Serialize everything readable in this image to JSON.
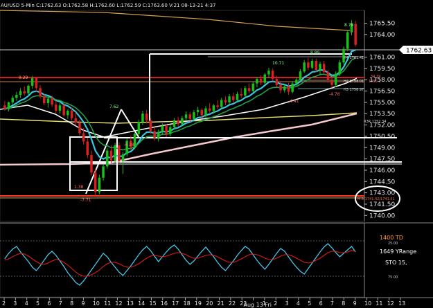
{
  "header": {
    "symbol": "AU/USD  5-Min",
    "ohlc": "C:1762.63  O:1762.58  H:1762.60  L:1762.59  C:1763.60  V:21  08-13-21  4:37",
    "full_line": "AU/USD 5-Min C:1762.63 O:1762.58 H:1762.60 L:1762.59 C:1763.60 V:21 08-13-21 4:37"
  },
  "colors": {
    "background": "#000000",
    "bullish_candle": "#18c118",
    "bearish_candle": "#d82020",
    "ema_fast": "#39c6e0",
    "ema_slow": "#22a04a",
    "white_ma": "#ffffff",
    "pink_ma": "#f6c8d0",
    "orange_line": "#d8a050",
    "yellow_ma": "#e8e070",
    "red_support": "#ff3a1a",
    "stoch_line": "#49c5e8",
    "stoch_signal": "#e01a1a"
  },
  "price_axis": {
    "ylim": [
      1739.2,
      1767.2
    ],
    "ticks": [
      "1765.50",
      "1764.00",
      "1761.00",
      "1759.50",
      "1758.00",
      "1756.50",
      "1755.00",
      "1753.50",
      "1752.00",
      "1750.50",
      "1749.00",
      "1747.50",
      "1746.00",
      "1744.50",
      "1743.00",
      "1741.50",
      "1740.00"
    ],
    "current_price": "1762.63"
  },
  "time_axis": {
    "labels": [
      "2",
      "3",
      "4",
      "5",
      "6",
      "7",
      "8",
      "9",
      "10",
      "11",
      "12",
      "13",
      "14",
      "15",
      "16",
      "17",
      "18",
      "19",
      "20",
      "21",
      "22",
      "23",
      "Aug 13 Fri",
      "1",
      "2",
      "3",
      "4",
      "5",
      "6",
      "7",
      "8",
      "9",
      "10",
      "11",
      "12",
      "13"
    ]
  },
  "chart_labels": {
    "high_label": "8.78",
    "left_label": "9.29",
    "mid_label": "7.62",
    "low_label": "-7.71",
    "low2_label": "-4.38",
    "low3_label": "1.38",
    "right_label1": "10.71",
    "right_label2": "-4.78",
    "right_label3": "8.89",
    "right_label4": "-4.41",
    "h4_level": "H4  1761.41",
    "h4b_level": "H4  1758.01",
    "h3_level": "H3  1756.97",
    "r3r_level": "R3R  1752.34",
    "red_right_a": "34.19",
    "red_right_b": "1760.1",
    "ml_level": "M.3  1741.42/1741.51"
  },
  "indicator": {
    "label_td": "1400 TD",
    "label_yrange": "1649 YRange",
    "label_sto": "STO  15,",
    "tick_top": "25.00",
    "tick_bottom": "75.00"
  },
  "chart_data": [
    {
      "type": "candlestick",
      "title": "",
      "ylim": [
        1739.2,
        1767.2
      ],
      "candles": [
        [
          1754.6,
          1755.2,
          1753.9,
          1754.1
        ],
        [
          1754.1,
          1755.1,
          1753.8,
          1755.0
        ],
        [
          1755.0,
          1755.9,
          1754.7,
          1755.6
        ],
        [
          1755.6,
          1756.4,
          1755.2,
          1756.0
        ],
        [
          1756.0,
          1756.9,
          1755.6,
          1756.5
        ],
        [
          1756.5,
          1757.1,
          1755.9,
          1756.2
        ],
        [
          1756.2,
          1757.4,
          1756.0,
          1757.2
        ],
        [
          1757.2,
          1758.5,
          1756.8,
          1758.2
        ],
        [
          1758.2,
          1758.4,
          1756.4,
          1756.9
        ],
        [
          1756.9,
          1757.3,
          1755.5,
          1755.8
        ],
        [
          1755.8,
          1756.1,
          1754.6,
          1754.9
        ],
        [
          1754.9,
          1755.7,
          1754.3,
          1755.5
        ],
        [
          1755.5,
          1755.9,
          1754.4,
          1754.7
        ],
        [
          1754.7,
          1755.2,
          1753.6,
          1753.9
        ],
        [
          1753.9,
          1754.9,
          1753.5,
          1754.6
        ],
        [
          1754.6,
          1754.9,
          1753.1,
          1753.3
        ],
        [
          1753.3,
          1754.1,
          1752.8,
          1753.9
        ],
        [
          1753.9,
          1754.3,
          1752.6,
          1752.9
        ],
        [
          1752.9,
          1753.7,
          1751.9,
          1752.3
        ],
        [
          1752.3,
          1752.7,
          1750.6,
          1750.9
        ],
        [
          1750.9,
          1751.6,
          1749.4,
          1749.8
        ],
        [
          1749.8,
          1750.3,
          1747.6,
          1748.0
        ],
        [
          1748.0,
          1748.6,
          1745.3,
          1745.7
        ],
        [
          1745.7,
          1746.2,
          1742.6,
          1743.1
        ],
        [
          1743.1,
          1745.4,
          1742.8,
          1745.0
        ],
        [
          1745.0,
          1746.8,
          1744.6,
          1746.5
        ],
        [
          1746.5,
          1748.9,
          1746.2,
          1748.6
        ],
        [
          1748.6,
          1749.3,
          1746.9,
          1747.3
        ],
        [
          1747.3,
          1749.6,
          1747.0,
          1749.3
        ],
        [
          1749.3,
          1749.7,
          1746.8,
          1747.2
        ],
        [
          1747.2,
          1748.4,
          1745.5,
          1748.1
        ],
        [
          1748.1,
          1750.2,
          1747.8,
          1749.9
        ],
        [
          1749.9,
          1750.6,
          1748.6,
          1749.0
        ],
        [
          1749.0,
          1751.1,
          1748.8,
          1750.8
        ],
        [
          1750.8,
          1752.7,
          1750.5,
          1752.4
        ],
        [
          1752.4,
          1753.9,
          1752.0,
          1753.5
        ],
        [
          1753.5,
          1754.0,
          1752.2,
          1752.6
        ],
        [
          1752.6,
          1752.9,
          1750.8,
          1751.2
        ],
        [
          1751.2,
          1751.7,
          1749.9,
          1750.3
        ],
        [
          1750.3,
          1751.4,
          1749.8,
          1751.1
        ],
        [
          1751.1,
          1752.2,
          1750.7,
          1751.9
        ],
        [
          1751.9,
          1752.1,
          1750.4,
          1750.8
        ],
        [
          1750.8,
          1752.0,
          1750.5,
          1751.7
        ],
        [
          1751.7,
          1752.9,
          1751.4,
          1752.6
        ],
        [
          1752.6,
          1753.1,
          1751.8,
          1752.1
        ],
        [
          1752.1,
          1753.2,
          1751.9,
          1752.9
        ],
        [
          1752.9,
          1753.8,
          1752.5,
          1753.4
        ],
        [
          1753.4,
          1753.7,
          1752.4,
          1752.8
        ],
        [
          1752.8,
          1754.0,
          1752.6,
          1753.7
        ],
        [
          1753.7,
          1754.4,
          1753.2,
          1754.0
        ],
        [
          1754.0,
          1754.2,
          1752.9,
          1753.3
        ],
        [
          1753.3,
          1754.5,
          1753.0,
          1754.2
        ],
        [
          1754.2,
          1754.9,
          1753.6,
          1753.9
        ],
        [
          1753.9,
          1754.8,
          1753.5,
          1754.6
        ],
        [
          1754.6,
          1755.3,
          1754.1,
          1754.4
        ],
        [
          1754.4,
          1755.6,
          1754.2,
          1755.3
        ],
        [
          1755.3,
          1755.8,
          1754.6,
          1755.0
        ],
        [
          1755.0,
          1756.1,
          1754.8,
          1755.8
        ],
        [
          1755.8,
          1756.3,
          1755.0,
          1755.3
        ],
        [
          1755.3,
          1756.4,
          1755.1,
          1756.1
        ],
        [
          1756.1,
          1756.9,
          1755.6,
          1755.9
        ],
        [
          1755.9,
          1757.2,
          1755.7,
          1756.9
        ],
        [
          1756.9,
          1757.5,
          1756.2,
          1756.5
        ],
        [
          1756.5,
          1757.8,
          1756.3,
          1757.5
        ],
        [
          1757.5,
          1758.4,
          1757.0,
          1758.1
        ],
        [
          1758.1,
          1758.6,
          1757.3,
          1757.6
        ],
        [
          1757.6,
          1758.9,
          1757.4,
          1758.7
        ],
        [
          1758.7,
          1759.6,
          1758.2,
          1759.2
        ],
        [
          1759.2,
          1759.5,
          1757.8,
          1758.1
        ],
        [
          1758.1,
          1758.5,
          1757.0,
          1757.3
        ],
        [
          1757.3,
          1757.8,
          1756.2,
          1756.6
        ],
        [
          1756.6,
          1757.4,
          1756.3,
          1757.1
        ],
        [
          1757.1,
          1757.6,
          1756.0,
          1756.4
        ],
        [
          1756.4,
          1757.7,
          1756.2,
          1757.5
        ],
        [
          1757.5,
          1758.3,
          1757.2,
          1758.0
        ],
        [
          1758.0,
          1759.4,
          1757.8,
          1759.1
        ],
        [
          1759.1,
          1760.6,
          1758.9,
          1760.3
        ],
        [
          1760.3,
          1760.9,
          1759.3,
          1759.6
        ],
        [
          1759.6,
          1760.8,
          1759.4,
          1760.5
        ],
        [
          1760.5,
          1760.8,
          1759.0,
          1759.3
        ],
        [
          1759.3,
          1760.4,
          1758.6,
          1760.1
        ],
        [
          1760.1,
          1760.5,
          1758.7,
          1759.0
        ],
        [
          1759.0,
          1759.3,
          1757.6,
          1757.9
        ],
        [
          1757.9,
          1758.4,
          1756.9,
          1757.3
        ],
        [
          1757.3,
          1759.1,
          1757.0,
          1758.8
        ],
        [
          1758.8,
          1760.6,
          1758.5,
          1760.3
        ],
        [
          1760.3,
          1762.4,
          1760.0,
          1762.1
        ],
        [
          1762.1,
          1764.6,
          1761.8,
          1764.3
        ],
        [
          1764.3,
          1765.9,
          1763.9,
          1765.4
        ],
        [
          1765.4,
          1765.8,
          1762.4,
          1762.63
        ]
      ]
    },
    {
      "type": "line",
      "title": "",
      "series": [
        {
          "values": [
            52,
            60,
            66,
            70,
            62,
            55,
            48,
            40,
            35,
            42,
            50,
            58,
            63,
            57,
            49,
            41,
            32,
            25,
            18,
            14,
            20,
            28,
            36,
            44,
            52,
            60,
            55,
            47,
            40,
            33,
            28,
            35,
            42,
            50,
            58,
            65,
            70,
            64,
            56,
            48,
            55,
            62,
            68,
            72,
            66,
            58,
            50,
            44,
            49,
            56,
            63,
            69,
            62,
            55,
            47,
            40,
            35,
            42,
            49,
            57,
            64,
            70,
            66,
            58,
            50,
            43,
            37,
            44,
            52,
            60,
            67,
            63,
            55,
            47,
            40,
            34,
            30,
            38,
            46,
            54,
            62,
            69,
            74,
            68,
            61,
            55,
            60,
            65,
            70,
            62
          ]
        },
        {
          "values": [
            50,
            52,
            55,
            58,
            60,
            59,
            56,
            52,
            48,
            45,
            44,
            46,
            49,
            51,
            50,
            47,
            43,
            38,
            33,
            29,
            27,
            27,
            29,
            32,
            36,
            41,
            45,
            47,
            47,
            45,
            42,
            40,
            40,
            42,
            45,
            49,
            53,
            56,
            57,
            56,
            55,
            56,
            58,
            60,
            61,
            60,
            58,
            55,
            53,
            53,
            55,
            57,
            58,
            57,
            55,
            52,
            49,
            47,
            47,
            49,
            52,
            55,
            58,
            59,
            58,
            56,
            53,
            51,
            51,
            53,
            56,
            58,
            58,
            56,
            53,
            50,
            47,
            46,
            47,
            50,
            53,
            57,
            61,
            63,
            63,
            61,
            61,
            62,
            64,
            63
          ]
        }
      ]
    }
  ]
}
